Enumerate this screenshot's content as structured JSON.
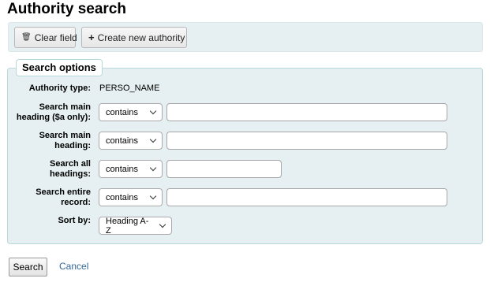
{
  "page": {
    "title": "Authority search"
  },
  "toolbar": {
    "clear_label": "Clear field",
    "create_label": "Create new authority"
  },
  "search_options": {
    "legend": "Search options",
    "authority_type": {
      "label": "Authority type:",
      "value": "PERSO_NAME"
    },
    "main_heading_a": {
      "label_line1": "Search main",
      "label_line2": "heading ($a only):",
      "operator": "contains",
      "value": ""
    },
    "main_heading": {
      "label_line1": "Search main",
      "label_line2": "heading:",
      "operator": "contains",
      "value": ""
    },
    "all_headings": {
      "label_line1": "Search all",
      "label_line2": "headings:",
      "operator": "contains",
      "value": ""
    },
    "entire_record": {
      "label_line1": "Search entire",
      "label_line2": "record:",
      "operator": "contains",
      "value": ""
    },
    "sort_by": {
      "label": "Sort by:",
      "value": "Heading A-Z"
    }
  },
  "actions": {
    "search_label": "Search",
    "cancel_label": "Cancel"
  },
  "icons": {
    "clear": "trash-icon",
    "create": "plus-icon",
    "dropdown": "chevron-down-icon"
  }
}
